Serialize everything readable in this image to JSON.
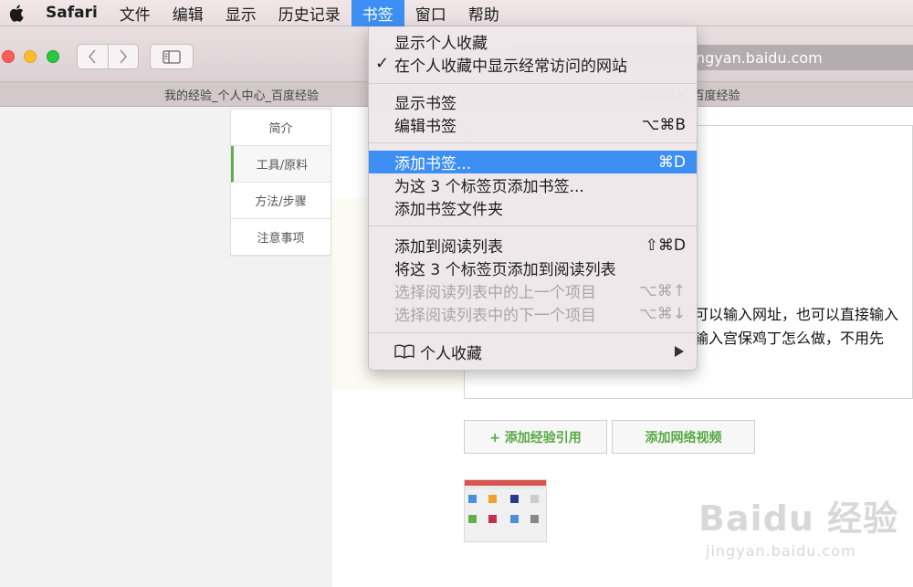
{
  "menubar": {
    "app_name": "Safari",
    "items": [
      {
        "label": "文件"
      },
      {
        "label": "编辑"
      },
      {
        "label": "显示"
      },
      {
        "label": "历史记录"
      },
      {
        "label": "书签"
      },
      {
        "label": "窗口"
      },
      {
        "label": "帮助"
      }
    ],
    "active_index": 4
  },
  "toolbar": {
    "address_text": "ngyan.baidu.com"
  },
  "tabs": [
    {
      "title": "我的经验_个人中心_百度经验"
    },
    {
      "title": "级编辑器_百度经验"
    }
  ],
  "side_nav": [
    {
      "label": "简介"
    },
    {
      "label": "工具/原料"
    },
    {
      "label": "方法/步骤"
    },
    {
      "label": "注意事项"
    }
  ],
  "editor": {
    "line1": "可以输入网址，也可以直接输入",
    "line2": "输入宫保鸡丁怎么做，不用先"
  },
  "buttons": {
    "add_reference": "+ 添加经验引用",
    "add_video": "添加网络视频"
  },
  "watermark": {
    "main": "Baidu 经验",
    "sub": "jingyan.baidu.com"
  },
  "bookmarks_menu": {
    "show_favorites": "显示个人收藏",
    "check": "✓",
    "show_frequent": "在个人收藏中显示经常访问的网站",
    "show_bookmarks": "显示书签",
    "edit_bookmarks": "编辑书签",
    "edit_bookmarks_sc": "⌥⌘B",
    "add_bookmark": "添加书签...",
    "add_bookmark_sc": "⌘D",
    "add_bookmark_tabs": "为这 3 个标签页添加书签...",
    "add_folder": "添加书签文件夹",
    "add_reading": "添加到阅读列表",
    "add_reading_sc": "⇧⌘D",
    "add_tabs_reading": "将这 3 个标签页添加到阅读列表",
    "prev_reading": "选择阅读列表中的上一个项目",
    "prev_reading_sc": "⌥⌘↑",
    "next_reading": "选择阅读列表中的下一个项目",
    "next_reading_sc": "⌥⌘↓",
    "favorites": "个人收藏"
  },
  "colors": {
    "menu_highlight": "#3e8ff4",
    "accent_green": "#56a844"
  }
}
